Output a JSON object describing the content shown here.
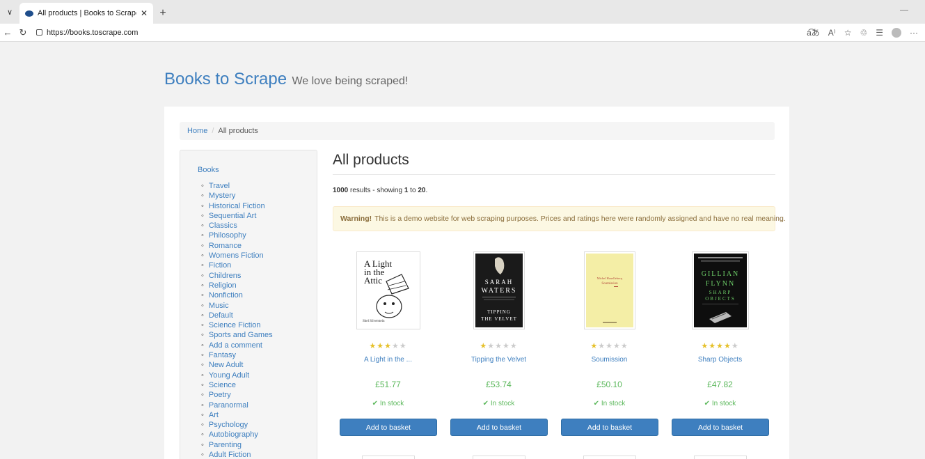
{
  "browser": {
    "tab_title": "All products | Books to Scrape - Sa",
    "tab_close": "✕",
    "new_tab": "+",
    "url": "https://books.toscrape.com"
  },
  "site": {
    "logo": "Books to Scrape",
    "tagline": "We love being scraped!"
  },
  "breadcrumb": {
    "home": "Home",
    "separator": "/",
    "current": "All products"
  },
  "sidebar": {
    "heading": "Books",
    "categories": [
      "Travel",
      "Mystery",
      "Historical Fiction",
      "Sequential Art",
      "Classics",
      "Philosophy",
      "Romance",
      "Womens Fiction",
      "Fiction",
      "Childrens",
      "Religion",
      "Nonfiction",
      "Music",
      "Default",
      "Science Fiction",
      "Sports and Games",
      "Add a comment",
      "Fantasy",
      "New Adult",
      "Young Adult",
      "Science",
      "Poetry",
      "Paranormal",
      "Art",
      "Psychology",
      "Autobiography",
      "Parenting",
      "Adult Fiction"
    ]
  },
  "main": {
    "title": "All products",
    "results_count": "1000",
    "results_text": " results - showing ",
    "results_from": "1",
    "results_to_text": " to ",
    "results_to": "20",
    "results_end": ".",
    "warning_label": "Warning!",
    "warning_text": "This is a demo website for web scraping purposes. Prices and ratings here were randomly assigned and have no real meaning."
  },
  "products": [
    {
      "title": "A Light in the ...",
      "price": "£51.77",
      "stock": "In stock",
      "rating": 3,
      "button": "Add to basket"
    },
    {
      "title": "Tipping the Velvet",
      "price": "£53.74",
      "stock": "In stock",
      "rating": 1,
      "button": "Add to basket"
    },
    {
      "title": "Soumission",
      "price": "£50.10",
      "stock": "In stock",
      "rating": 1,
      "button": "Add to basket"
    },
    {
      "title": "Sharp Objects",
      "price": "£47.82",
      "stock": "In stock",
      "rating": 4,
      "button": "Add to basket"
    }
  ],
  "covers": {
    "c1": {
      "line1": "A Light",
      "line2": "in the",
      "line3": "Attic",
      "author": "Shel Silverstein"
    },
    "c2": {
      "author1": "SARAH",
      "author2": "WATERS",
      "title1": "TIPPING",
      "title2": "THE VELVET"
    },
    "c3": {
      "author": "Michel Houellebecq",
      "title": "Soumission"
    },
    "c4": {
      "author1": "GILLIAN",
      "author2": "FLYNN",
      "title1": "SHARP",
      "title2": "OBJECTS"
    }
  },
  "colors": {
    "accent": "#3e7fbf",
    "price": "#5cb85c",
    "star": "#e6c12c"
  }
}
